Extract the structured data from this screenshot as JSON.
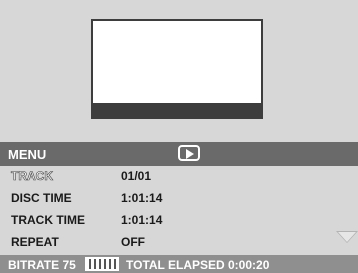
{
  "menu": {
    "label": "MENU",
    "play_icon": "play-icon"
  },
  "rows": [
    {
      "label": "TRACK",
      "value": "01/01"
    },
    {
      "label": "DISC TIME",
      "value": "1:01:14"
    },
    {
      "label": "TRACK TIME",
      "value": "1:01:14"
    },
    {
      "label": "REPEAT",
      "value": "OFF"
    }
  ],
  "status": {
    "bitrate": "BITRATE 75",
    "total_elapsed": "TOTAL ELAPSED 0:00:20"
  }
}
